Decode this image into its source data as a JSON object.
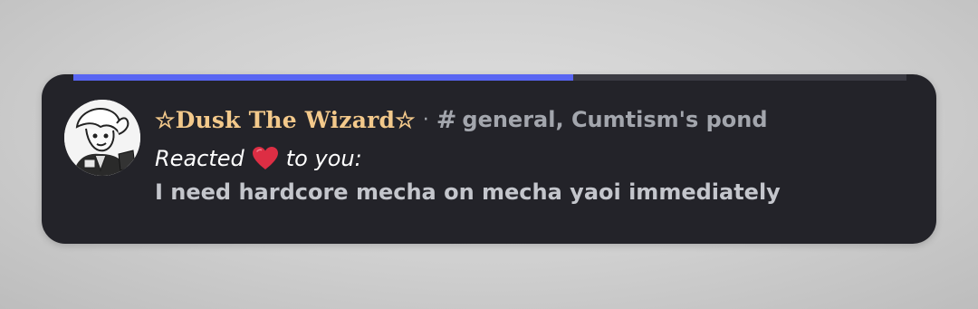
{
  "notification": {
    "progress_fraction": 0.6,
    "author": {
      "display_name": "☆Dusk The Wizard☆",
      "avatar_icon": "avatar"
    },
    "separator": "·",
    "channel_icon": "hash-icon",
    "channel_text": "general, Cumtism's pond",
    "reaction": {
      "prefix": "Reacted",
      "emoji_icon": "red-heart-icon",
      "suffix": "to you:"
    },
    "message": "I need hardcore mecha on mecha yaoi immediately"
  },
  "colors": {
    "toast_background": "#232329",
    "progress_fill": "#5865f2",
    "username": "#f3c98b",
    "meta_text": "#a3a6ad",
    "message_text": "#c4c6cc"
  }
}
